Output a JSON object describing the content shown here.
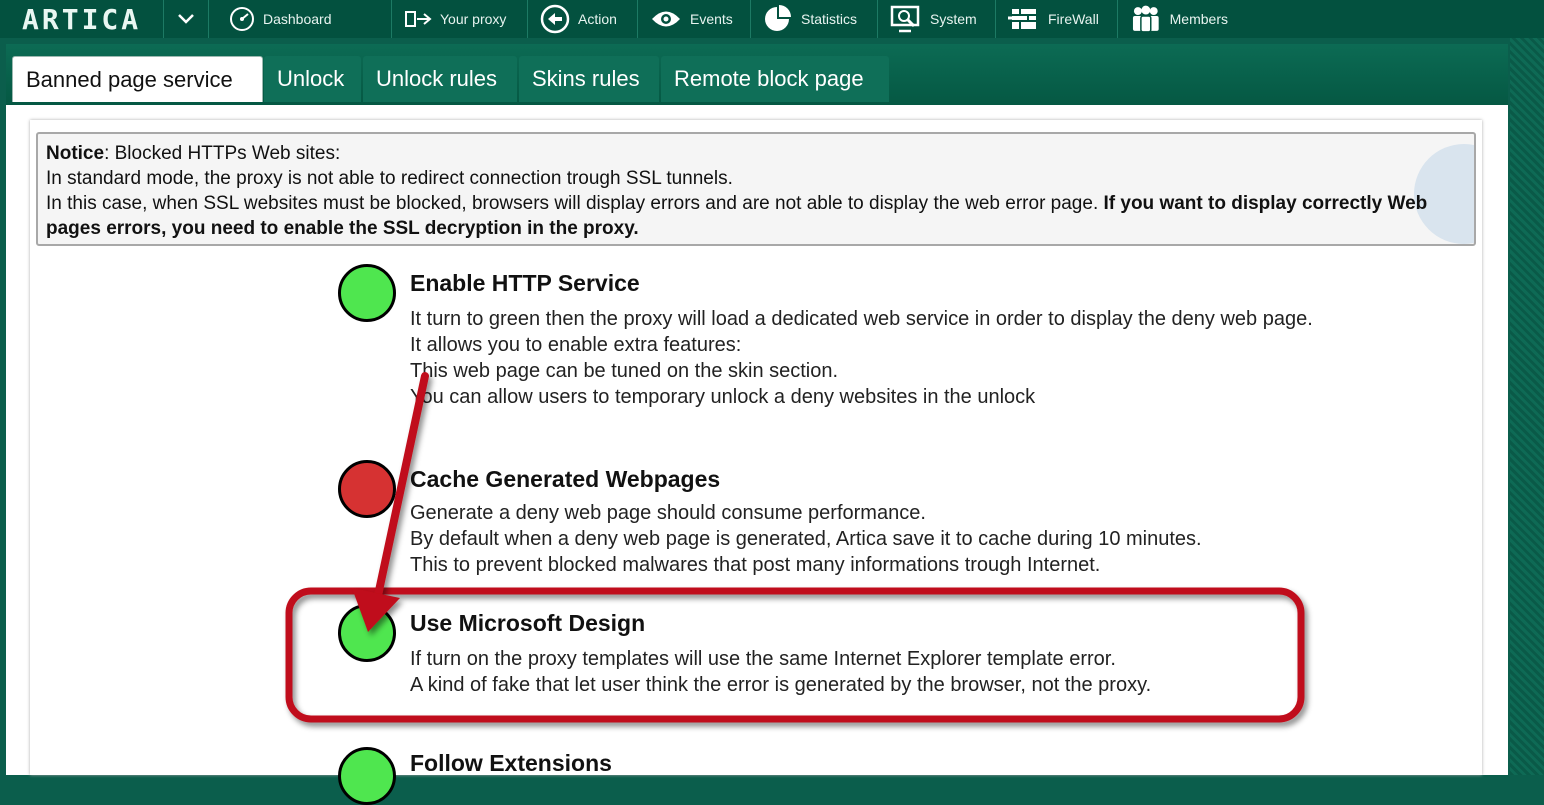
{
  "app": {
    "logo": "ARTICA"
  },
  "nav": {
    "items": [
      {
        "label": "Dashboard",
        "icon": "dashboard-icon"
      },
      {
        "label": "Your proxy",
        "icon": "proxy-icon"
      },
      {
        "label": "Action",
        "icon": "action-icon"
      },
      {
        "label": "Events",
        "icon": "eye-icon"
      },
      {
        "label": "Statistics",
        "icon": "pie-chart-icon"
      },
      {
        "label": "System",
        "icon": "system-icon"
      },
      {
        "label": "FireWall",
        "icon": "firewall-icon"
      },
      {
        "label": "Members",
        "icon": "members-icon"
      }
    ]
  },
  "tabs": [
    {
      "label": "Banned page service",
      "active": true
    },
    {
      "label": "Unlock",
      "active": false
    },
    {
      "label": "Unlock rules",
      "active": false
    },
    {
      "label": "Skins rules",
      "active": false
    },
    {
      "label": "Remote block page",
      "active": false
    }
  ],
  "notice": {
    "label": "Notice",
    "heading": ": Blocked HTTPs Web sites:",
    "line1": "In standard mode, the proxy is not able to redirect connection trough SSL tunnels.",
    "line2": "In this case, when SSL websites must be blocked, browsers will display errors and are not able to display the web error page. ",
    "line2_bold": "If you want to display correctly Web pages errors, you need to enable the SSL decryption in the proxy."
  },
  "features": [
    {
      "title": "Enable HTTP Service",
      "enabled": true,
      "lines": [
        "It turn to green then the proxy will load a dedicated web service in order to display the deny web page.",
        "It allows you to enable extra features:",
        "This web page can be tuned on the skin section.",
        "You can allow users to temporary unlock a deny websites in the unlock"
      ]
    },
    {
      "title": "Cache Generated Webpages",
      "enabled": false,
      "lines": [
        "Generate a deny web page should consume performance.",
        "By default when a deny web page is generated, Artica save it to cache during 10 minutes.",
        "This to prevent blocked malwares that post many informations trough Internet."
      ]
    },
    {
      "title": "Use Microsoft Design",
      "enabled": true,
      "lines": [
        "If turn on the proxy templates will use the same Internet Explorer template error.",
        "A kind of fake that let user think the error is generated by the browser, not the proxy."
      ]
    },
    {
      "title": "Follow Extensions",
      "enabled": true,
      "lines": []
    }
  ],
  "colors": {
    "brand": "#03513f",
    "led_on": "#4fe64f",
    "led_off": "#d63232",
    "highlight": "#c0101a"
  }
}
